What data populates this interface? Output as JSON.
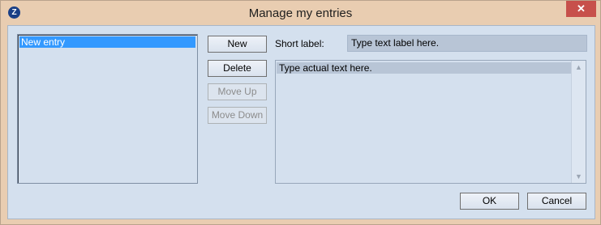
{
  "window": {
    "title": "Manage my entries",
    "close_glyph": "✕",
    "app_icon": "app-logo-icon"
  },
  "entries_list": {
    "items": [
      {
        "label": "New entry",
        "selected": true
      }
    ]
  },
  "buttons": {
    "new": "New",
    "delete": "Delete",
    "move_up": "Move Up",
    "move_down": "Move Down",
    "ok": "OK",
    "cancel": "Cancel"
  },
  "form": {
    "short_label_caption": "Short label:",
    "short_label_value": "Type text label here.",
    "text_value": "Type actual text here."
  },
  "colors": {
    "title_bar": "#e9cdb1",
    "client_bg": "#d4e0ee",
    "selection": "#3399ff",
    "close_button": "#c7504b"
  }
}
